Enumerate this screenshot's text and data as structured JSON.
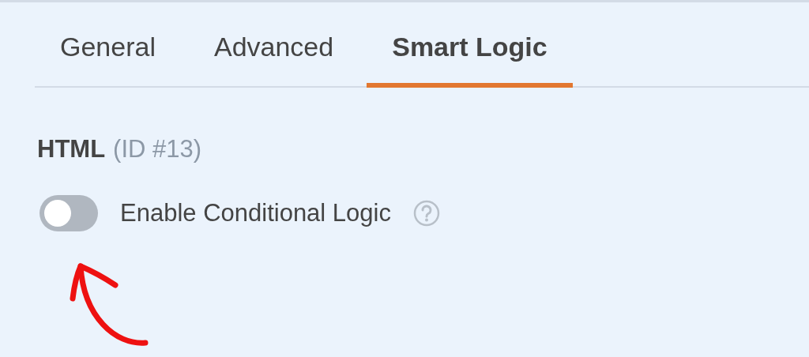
{
  "tabs": [
    {
      "label": "General",
      "selected": false
    },
    {
      "label": "Advanced",
      "selected": false
    },
    {
      "label": "Smart Logic",
      "selected": true
    }
  ],
  "field": {
    "name": "HTML",
    "id": "(ID #13)"
  },
  "toggle": {
    "label": "Enable Conditional Logic",
    "on": false
  }
}
